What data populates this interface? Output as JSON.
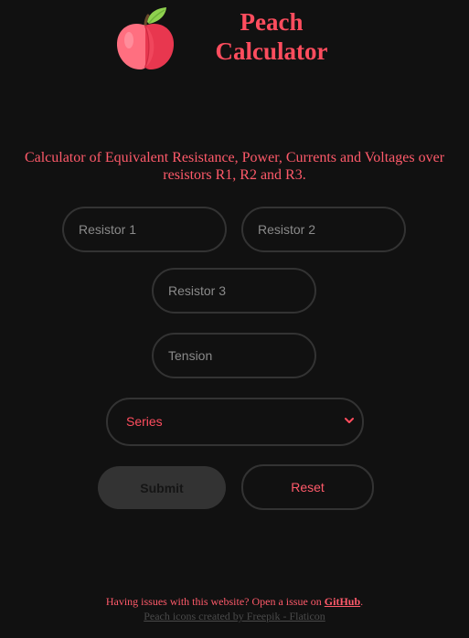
{
  "app": {
    "title": "Peach Calculator",
    "title_line1": "Peach",
    "title_line2": "Calculator",
    "logo_icon": "peach-icon"
  },
  "description": "Calculator of Equivalent Resistance, Power, Currents and Voltages over resistors R1, R2 and R3.",
  "form": {
    "resistor1_placeholder": "Resistor 1",
    "resistor2_placeholder": "Resistor 2",
    "resistor3_placeholder": "Resistor 3",
    "tension_placeholder": "Tension",
    "connection_select": {
      "selected": "Series",
      "arrow_icon": "chevron-down-icon"
    },
    "submit_label": "Submit",
    "reset_label": "Reset"
  },
  "footer": {
    "issue_text": "Having issues with this website? Open a issue on ",
    "github_link": "GitHub",
    "issue_suffix": ".",
    "credits": "Peach icons created by Freepik - Flaticon"
  },
  "colors": {
    "background": "#111111",
    "accent": "#ff4d5e",
    "border": "#333333",
    "placeholder": "#8a8a8a",
    "submit_bg": "#333333",
    "credits_text": "#4a4a4a"
  }
}
